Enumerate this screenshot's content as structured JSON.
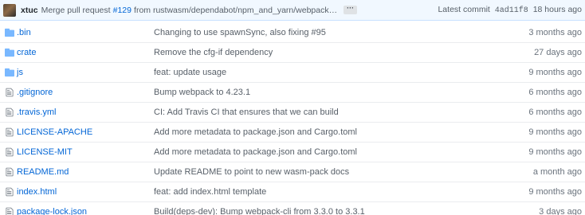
{
  "header": {
    "author": "xtuc",
    "message_prefix": "Merge pull request",
    "pr_link": "#129",
    "message_suffix": "from rustwasm/dependabot/npm_and_yarn/webpack…",
    "ellipsis": "···",
    "latest_label": "Latest commit",
    "sha": "4ad11f8",
    "age": "18 hours ago"
  },
  "files": [
    {
      "name": ".bin",
      "type": "folder",
      "message": "Changing to use spawnSync, also fixing #95",
      "age": "3 months ago"
    },
    {
      "name": "crate",
      "type": "folder",
      "message": "Remove the cfg-if dependency",
      "age": "27 days ago"
    },
    {
      "name": "js",
      "type": "folder",
      "message": "feat: update usage",
      "age": "9 months ago"
    },
    {
      "name": ".gitignore",
      "type": "file",
      "message": "Bump webpack to 4.23.1",
      "age": "6 months ago"
    },
    {
      "name": ".travis.yml",
      "type": "file",
      "message": "CI: Add Travis CI that ensures that we can build",
      "age": "6 months ago"
    },
    {
      "name": "LICENSE-APACHE",
      "type": "file",
      "message": "Add more metadata to package.json and Cargo.toml",
      "age": "9 months ago"
    },
    {
      "name": "LICENSE-MIT",
      "type": "file",
      "message": "Add more metadata to package.json and Cargo.toml",
      "age": "9 months ago"
    },
    {
      "name": "README.md",
      "type": "file",
      "message": "Update README to point to new wasm-pack docs",
      "age": "a month ago"
    },
    {
      "name": "index.html",
      "type": "file",
      "message": "feat: add index.html template",
      "age": "9 months ago"
    },
    {
      "name": "package-lock.json",
      "type": "file",
      "message": "Build(deps-dev): Bump webpack-cli from 3.3.0 to 3.3.1",
      "age": "3 days ago"
    }
  ],
  "colors": {
    "folder_icon": "#79b8ff",
    "file_icon": "#6a737d",
    "link": "#0366d6"
  }
}
